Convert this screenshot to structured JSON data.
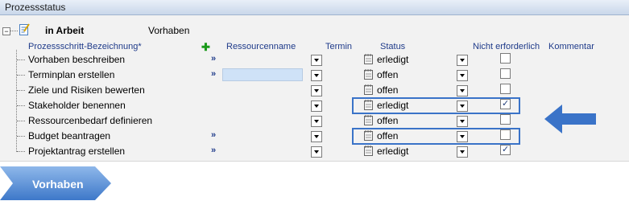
{
  "window": {
    "title": "Prozessstatus"
  },
  "header": {
    "expander_symbol": "−",
    "state_label": "in Arbeit",
    "phase_label": "Vorhaben"
  },
  "columns": {
    "step_name": "Prozessschritt-Bezeichnung*",
    "add_symbol": "✚",
    "resource": "Ressourcenname",
    "date": "Termin",
    "status": "Status",
    "not_required": "Nicht erforderlich",
    "comment": "Kommentar"
  },
  "rows": [
    {
      "name": "Vorhaben beschreiben",
      "link": "»",
      "status": "erledigt",
      "not_required": false
    },
    {
      "name": "Terminplan  erstellen",
      "link": "»",
      "status": "offen",
      "not_required": false
    },
    {
      "name": "Ziele und Risiken bewerten",
      "link": "",
      "status": "offen",
      "not_required": false
    },
    {
      "name": "Stakeholder benennen",
      "link": "",
      "status": "erledigt",
      "not_required": true
    },
    {
      "name": "Ressourcenbedarf definieren",
      "link": "",
      "status": "offen",
      "not_required": false
    },
    {
      "name": "Budget beantragen",
      "link": "»",
      "status": "offen",
      "not_required": false
    },
    {
      "name": "Projektantrag erstellen",
      "link": "»",
      "status": "erledigt",
      "not_required": true
    }
  ],
  "footer": {
    "phase_tab": "Vorhaben"
  },
  "colors": {
    "highlight": "#3a73c8",
    "arrow": "#3a73c8",
    "link": "#1f3b8a",
    "tab": "#5a8fd6"
  },
  "icons": [
    "document-edit-icon",
    "calendar-icon",
    "dropdown-arrow-icon",
    "left-arrow-icon"
  ]
}
